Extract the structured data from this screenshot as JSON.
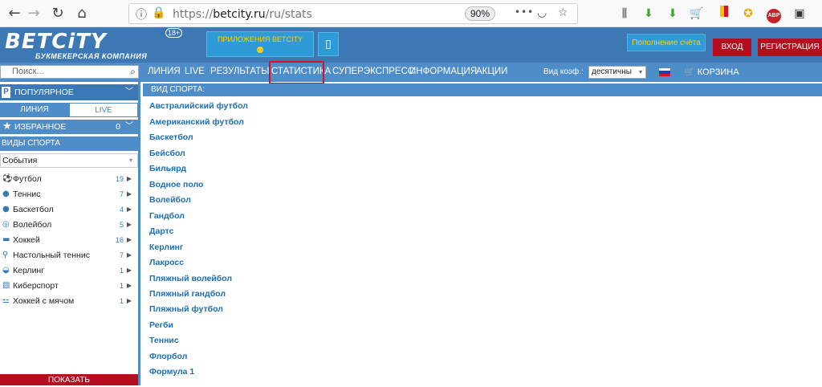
{
  "browser": {
    "url_scheme": "https://",
    "url_host": "betcity.ru",
    "url_path": "/ru/stats",
    "zoom": "90%",
    "more_icon": "•••",
    "extension_abp": "ABP"
  },
  "header": {
    "logo": "BETCiTY",
    "logo_tagline": "БУКМЕКЕРСКАЯ КОМПАНИЯ",
    "age_badge": "18+",
    "apps_label": "ПРИЛОЖЕНИЯ BETCITY",
    "topup_label": "Пополнение счёта",
    "login_label": "ВХОД",
    "register_label": "РЕГИСТРАЦИЯ"
  },
  "nav": {
    "search_placeholder": "Поиск...",
    "items": [
      "ЛИНИЯ",
      "LIVE",
      "РЕЗУЛЬТАТЫ",
      "СТАТИСТИКА",
      "СУПЕРЭКСПРЕСС",
      "ИНФОРМАЦИЯ",
      "АКЦИИ"
    ],
    "koef_label": "Вид коэф.:",
    "koef_value": "десятичны",
    "cart_label": "КОРЗИНА",
    "active_item": "СТАТИСТИКА"
  },
  "sidebar": {
    "popular_label": "ПОПУЛЯРНОЕ",
    "tab_line": "ЛИНИЯ",
    "tab_live": "LIVE",
    "favorites_label": "ИЗБРАННОЕ",
    "favorites_count": "0",
    "sports_header": "ВИДЫ СПОРТА",
    "events_select": "События",
    "sports": [
      {
        "name": "Футбол",
        "count": "19",
        "icon": "soccer-ball-icon"
      },
      {
        "name": "Теннис",
        "count": "7",
        "icon": "tennis-ball-icon"
      },
      {
        "name": "Баскетбол",
        "count": "4",
        "icon": "basketball-icon"
      },
      {
        "name": "Волейбол",
        "count": "5",
        "icon": "volleyball-icon"
      },
      {
        "name": "Хоккей",
        "count": "16",
        "icon": "hockey-puck-icon"
      },
      {
        "name": "Настольный теннис",
        "count": "7",
        "icon": "table-tennis-icon"
      },
      {
        "name": "Керлинг",
        "count": "1",
        "icon": "curling-icon"
      },
      {
        "name": "Киберспорт",
        "count": "1",
        "icon": "esports-icon"
      },
      {
        "name": "Хоккей с мячом",
        "count": "1",
        "icon": "bandy-icon"
      }
    ],
    "show_button": "ПОКАЗАТЬ"
  },
  "content": {
    "header": "ВИД СПОРТА:",
    "sports": [
      "Австралийский футбол",
      "Американский футбол",
      "Баскетбол",
      "Бейсбол",
      "Бильярд",
      "Водное поло",
      "Волейбол",
      "Гандбол",
      "Дартс",
      "Керлинг",
      "Лакросс",
      "Пляжный волейбол",
      "Пляжный гандбол",
      "Пляжный футбол",
      "Регби",
      "Теннис",
      "Флорбол",
      "Формула 1"
    ]
  },
  "colors": {
    "brand_blue": "#3b78b4",
    "nav_blue": "#4e8dc8",
    "accent_red": "#b50f1f",
    "highlight_red": "#d9121f",
    "link_blue": "#1d6fb2",
    "yellow": "#ffd200"
  }
}
